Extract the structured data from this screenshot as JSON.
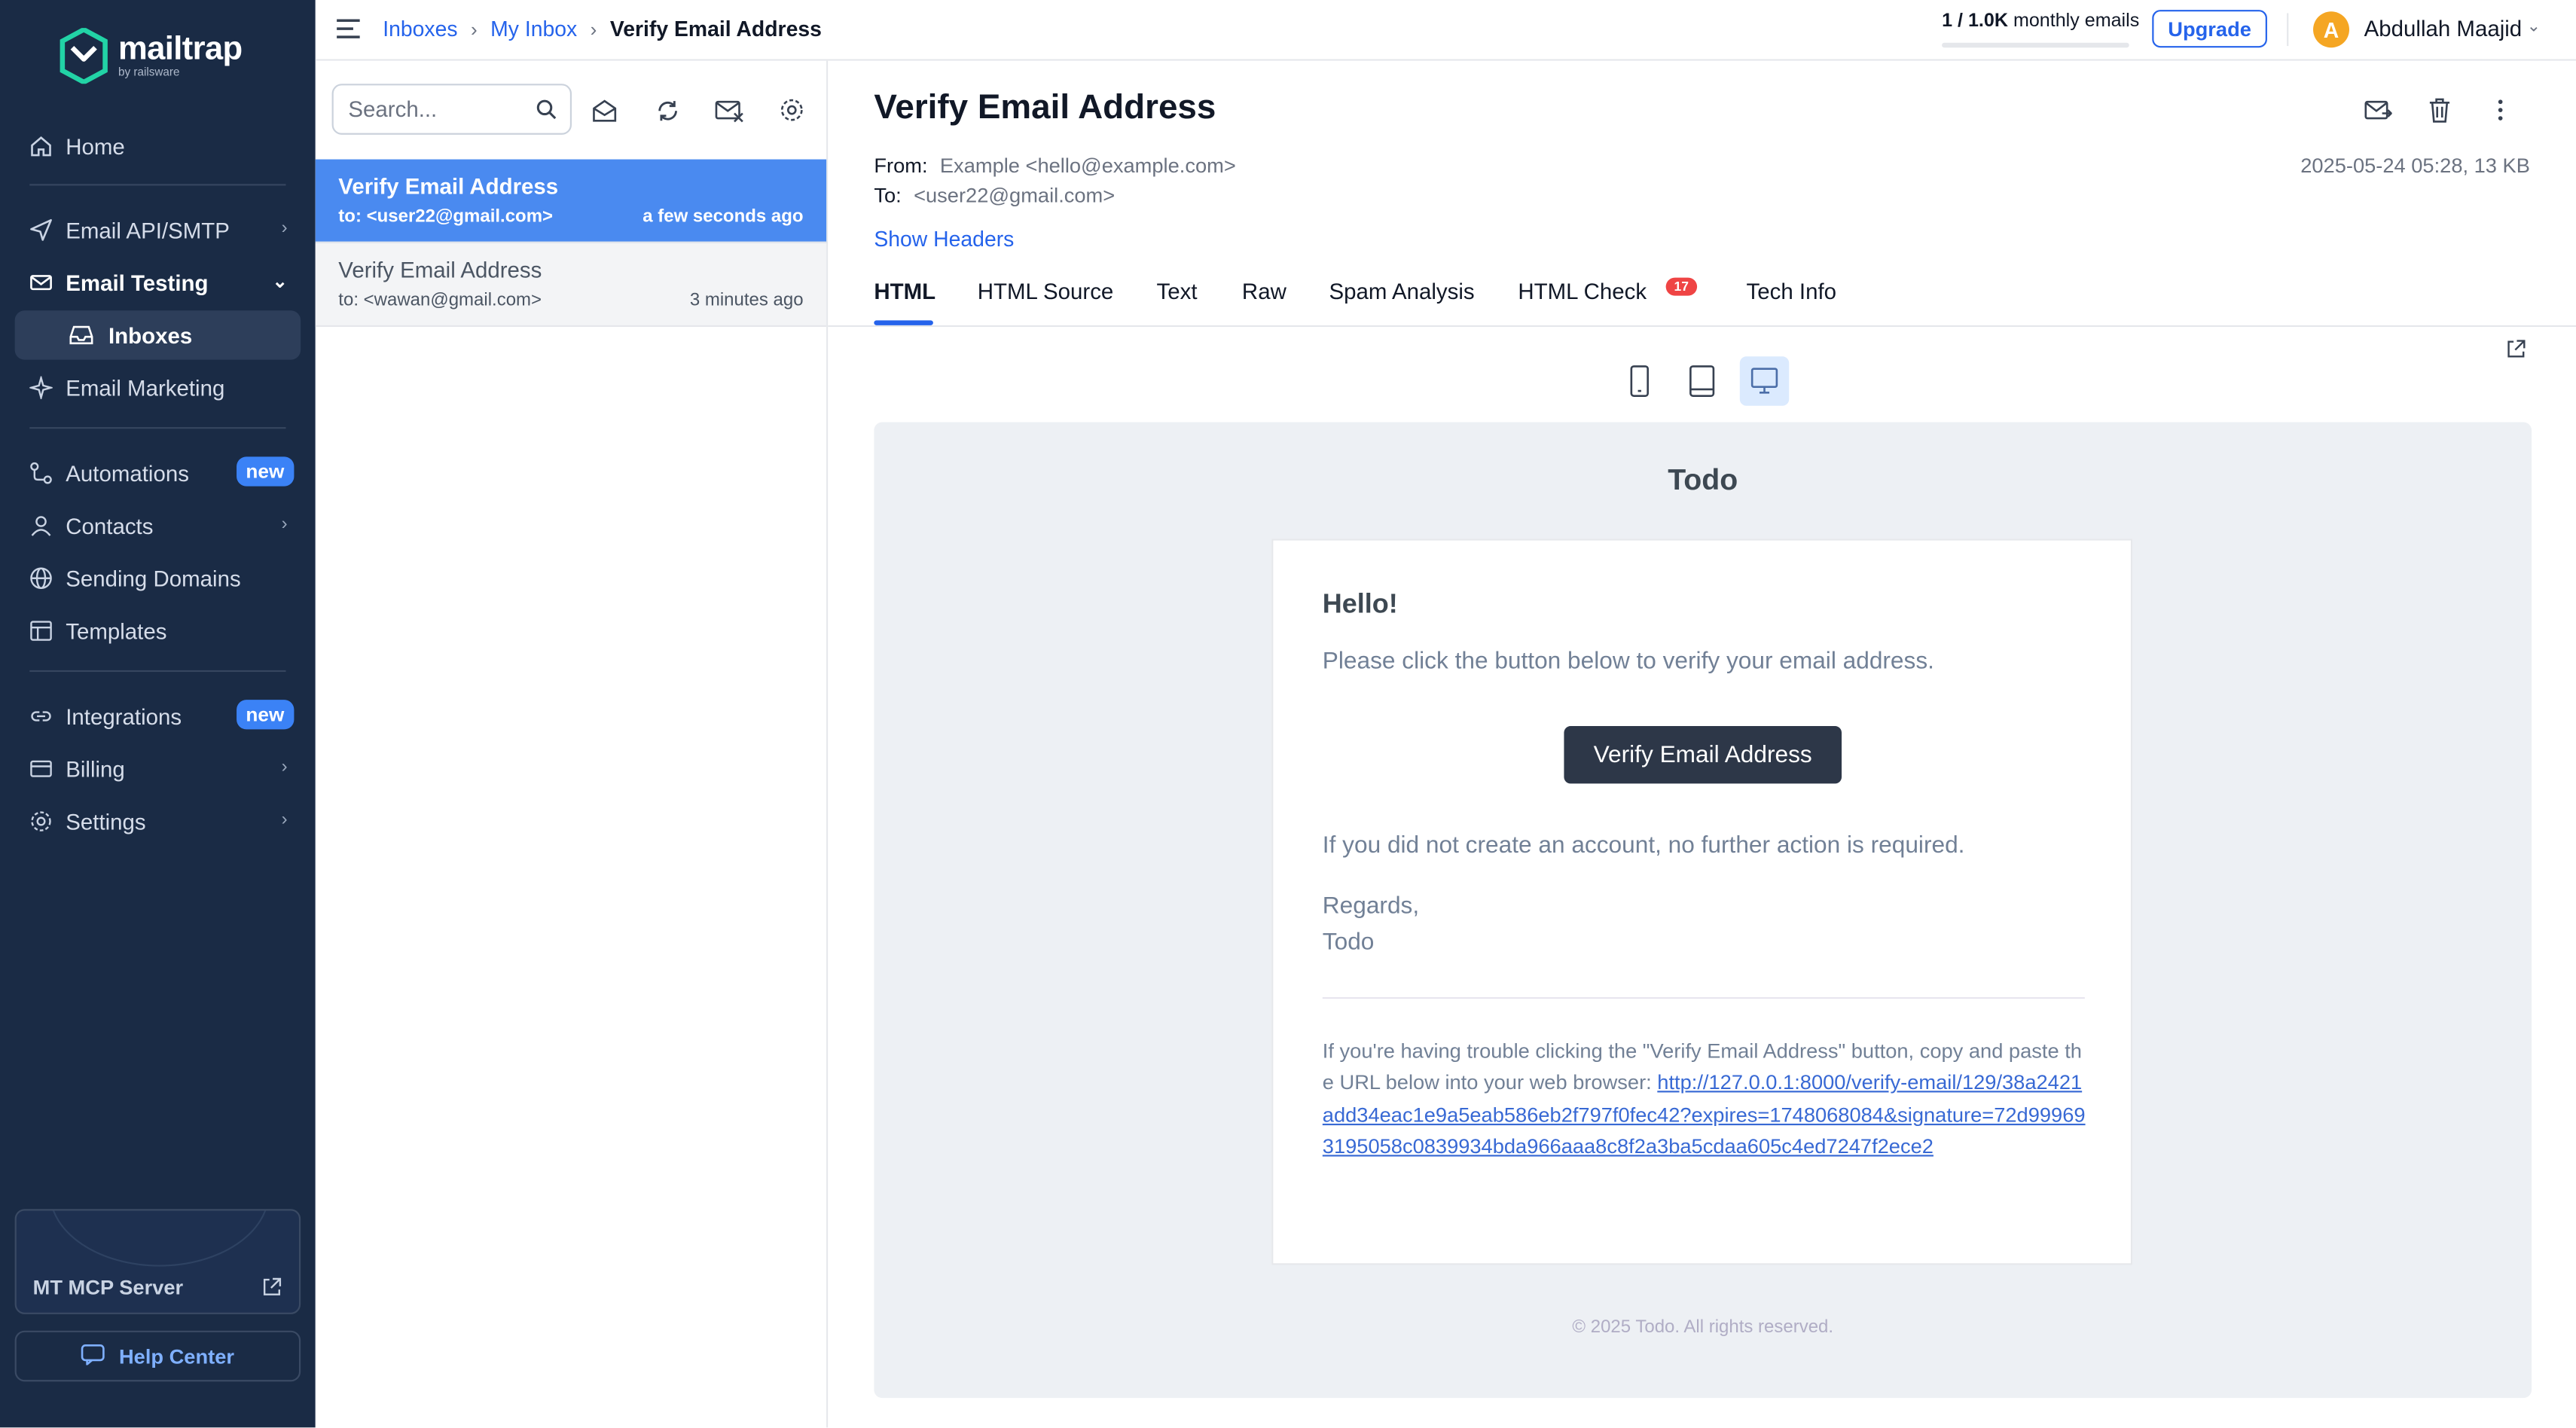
{
  "brand": {
    "name": "mailtrap",
    "sub": "by railsware"
  },
  "sidebar": {
    "items": [
      {
        "label": "Home"
      },
      {
        "label": "Email API/SMTP"
      },
      {
        "label": "Email Testing"
      },
      {
        "label": "Inboxes"
      },
      {
        "label": "Email Marketing"
      },
      {
        "label": "Automations",
        "badge": "new"
      },
      {
        "label": "Contacts"
      },
      {
        "label": "Sending Domains"
      },
      {
        "label": "Templates"
      },
      {
        "label": "Integrations",
        "badge": "new"
      },
      {
        "label": "Billing"
      },
      {
        "label": "Settings"
      }
    ],
    "mcp_label": "MT MCP Server",
    "help_label": "Help Center"
  },
  "topbar": {
    "breadcrumbs": [
      "Inboxes",
      "My Inbox",
      "Verify Email Address"
    ],
    "quota_used": "1",
    "quota_total": "1.0K",
    "quota_suffix": "monthly emails",
    "upgrade_label": "Upgrade",
    "user_initial": "A",
    "user_name": "Abdullah Maajid"
  },
  "list": {
    "search_placeholder": "Search...",
    "messages": [
      {
        "subject": "Verify Email Address",
        "to": "to: <user22@gmail.com>",
        "time": "a few seconds ago",
        "selected": true
      },
      {
        "subject": "Verify Email Address",
        "to": "to: <wawan@gmail.com>",
        "time": "3 minutes ago",
        "selected": false
      }
    ]
  },
  "email": {
    "subject": "Verify Email Address",
    "from_label": "From:",
    "from": "Example <hello@example.com>",
    "to_label": "To:",
    "to": "<user22@gmail.com>",
    "date_size": "2025-05-24 05:28, 13 KB",
    "show_headers": "Show Headers",
    "tabs": [
      "HTML",
      "HTML Source",
      "Text",
      "Raw",
      "Spam Analysis",
      "HTML Check",
      "Tech Info"
    ],
    "html_check_count": "17",
    "active_tab": "HTML",
    "preview": {
      "app_name": "Todo",
      "greeting": "Hello!",
      "intro": "Please click the button below to verify your email address.",
      "button": "Verify Email Address",
      "outro": "If you did not create an account, no further action is required.",
      "regards": "Regards,",
      "signature": "Todo",
      "trouble_text": "If you're having trouble clicking the \"Verify Email Address\" button, copy and paste the URL below into your web browser: ",
      "url": "http://127.0.0.1:8000/verify-email/129/38a2421add34eac1e9a5eab586eb2f797f0fec42?expires=1748068084&signature=72d999693195058c0839934bda966aaa8c8f2a3ba5cdaa605c4ed7247f2ece2",
      "footer": "© 2025 Todo. All rights reserved."
    }
  },
  "colors": {
    "sidebar_bg": "#1a2b45",
    "accent": "#2563eb",
    "selected_row": "#4a8af0",
    "badge_new": "#3b82f6",
    "badge_alert": "#ef4444",
    "button_dark": "#2d3748"
  }
}
